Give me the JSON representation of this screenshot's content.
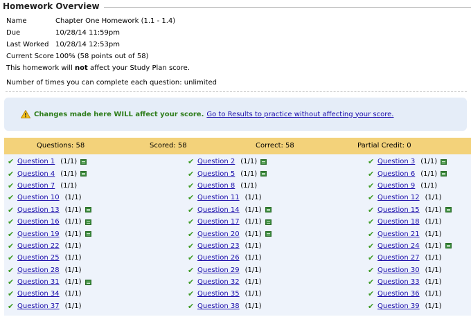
{
  "overview": {
    "title": "Homework Overview",
    "fields": [
      {
        "label": "Name",
        "value": "Chapter One Homework (1.1 - 1.4)"
      },
      {
        "label": "Due",
        "value": "10/28/14 11:59pm"
      },
      {
        "label": "Last Worked",
        "value": "10/28/14 12:53pm"
      },
      {
        "label": "Current Score",
        "value": "100% (58 points out of 58)"
      }
    ],
    "study_plan": {
      "before": "This homework will ",
      "bold": "not",
      "after": " affect your Study Plan score."
    },
    "attempts": "Number of times you can complete each question: unlimited"
  },
  "notice": {
    "warning": "Changes made here WILL affect your score.",
    "link": "Go to Results to practice without affecting your score."
  },
  "summary": {
    "questions": "Questions: 58",
    "scored": "Scored: 58",
    "correct": "Correct: 58",
    "partial": "Partial Credit: 0"
  },
  "questions": {
    "columns": [
      [
        {
          "label": "Question 1",
          "score": "(1/1)",
          "icon": true
        },
        {
          "label": "Question 4",
          "score": "(1/1)",
          "icon": true
        },
        {
          "label": "Question 7",
          "score": "(1/1)",
          "icon": false
        },
        {
          "label": "Question 10",
          "score": "(1/1)",
          "icon": false
        },
        {
          "label": "Question 13",
          "score": "(1/1)",
          "icon": true
        },
        {
          "label": "Question 16",
          "score": "(1/1)",
          "icon": true
        },
        {
          "label": "Question 19",
          "score": "(1/1)",
          "icon": true
        },
        {
          "label": "Question 22",
          "score": "(1/1)",
          "icon": false
        },
        {
          "label": "Question 25",
          "score": "(1/1)",
          "icon": false
        },
        {
          "label": "Question 28",
          "score": "(1/1)",
          "icon": false
        },
        {
          "label": "Question 31",
          "score": "(1/1)",
          "icon": true
        },
        {
          "label": "Question 34",
          "score": "(1/1)",
          "icon": false
        },
        {
          "label": "Question 37",
          "score": "(1/1)",
          "icon": false
        }
      ],
      [
        {
          "label": "Question 2",
          "score": "(1/1)",
          "icon": true
        },
        {
          "label": "Question 5",
          "score": "(1/1)",
          "icon": true
        },
        {
          "label": "Question 8",
          "score": "(1/1)",
          "icon": false
        },
        {
          "label": "Question 11",
          "score": "(1/1)",
          "icon": false
        },
        {
          "label": "Question 14",
          "score": "(1/1)",
          "icon": true
        },
        {
          "label": "Question 17",
          "score": "(1/1)",
          "icon": true
        },
        {
          "label": "Question 20",
          "score": "(1/1)",
          "icon": true
        },
        {
          "label": "Question 23",
          "score": "(1/1)",
          "icon": false
        },
        {
          "label": "Question 26",
          "score": "(1/1)",
          "icon": false
        },
        {
          "label": "Question 29",
          "score": "(1/1)",
          "icon": false
        },
        {
          "label": "Question 32",
          "score": "(1/1)",
          "icon": false
        },
        {
          "label": "Question 35",
          "score": "(1/1)",
          "icon": false
        },
        {
          "label": "Question 38",
          "score": "(1/1)",
          "icon": false
        }
      ],
      [
        {
          "label": "Question 3",
          "score": "(1/1)",
          "icon": true
        },
        {
          "label": "Question 6",
          "score": "(1/1)",
          "icon": true
        },
        {
          "label": "Question 9",
          "score": "(1/1)",
          "icon": false
        },
        {
          "label": "Question 12",
          "score": "(1/1)",
          "icon": false
        },
        {
          "label": "Question 15",
          "score": "(1/1)",
          "icon": true
        },
        {
          "label": "Question 18",
          "score": "(1/1)",
          "icon": false
        },
        {
          "label": "Question 21",
          "score": "(1/1)",
          "icon": false
        },
        {
          "label": "Question 24",
          "score": "(1/1)",
          "icon": true
        },
        {
          "label": "Question 27",
          "score": "(1/1)",
          "icon": false
        },
        {
          "label": "Question 30",
          "score": "(1/1)",
          "icon": false
        },
        {
          "label": "Question 33",
          "score": "(1/1)",
          "icon": false
        },
        {
          "label": "Question 36",
          "score": "(1/1)",
          "icon": false
        },
        {
          "label": "Question 39",
          "score": "(1/1)",
          "icon": false
        }
      ]
    ]
  },
  "colors": {
    "link": "#1a0dab",
    "check": "#3c9a22",
    "summary_bg": "#f3d27a",
    "grid_bg": "#eef3fb",
    "notice_bg": "#e5edf8"
  }
}
